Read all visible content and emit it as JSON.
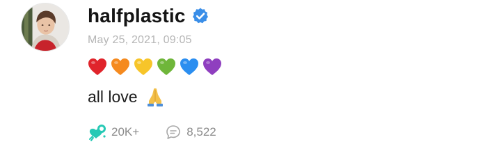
{
  "post": {
    "author": {
      "username": "halfplastic",
      "verified": true,
      "avatar_icon": "user-avatar-photo"
    },
    "timestamp": "May 25, 2021, 09:05",
    "hearts": [
      {
        "icon": "red-heart-icon",
        "color": "#e0242b"
      },
      {
        "icon": "orange-heart-icon",
        "color": "#f58a1f"
      },
      {
        "icon": "yellow-heart-icon",
        "color": "#f7c52a"
      },
      {
        "icon": "green-heart-icon",
        "color": "#6fb63a"
      },
      {
        "icon": "blue-heart-icon",
        "color": "#2b8ef0"
      },
      {
        "icon": "purple-heart-icon",
        "color": "#8f3fbf"
      }
    ],
    "message": {
      "text": "all love",
      "emoji_icon": "folded-hands-icon"
    },
    "stats": {
      "likes": "20K+",
      "likes_icon": "like-heart-icon",
      "comments": "8,522",
      "comments_icon": "comment-bubble-icon"
    },
    "colors": {
      "verified_badge": "#3a8ee8",
      "like_icon": "#27c9b5",
      "muted_text": "#b5b5b5"
    }
  }
}
